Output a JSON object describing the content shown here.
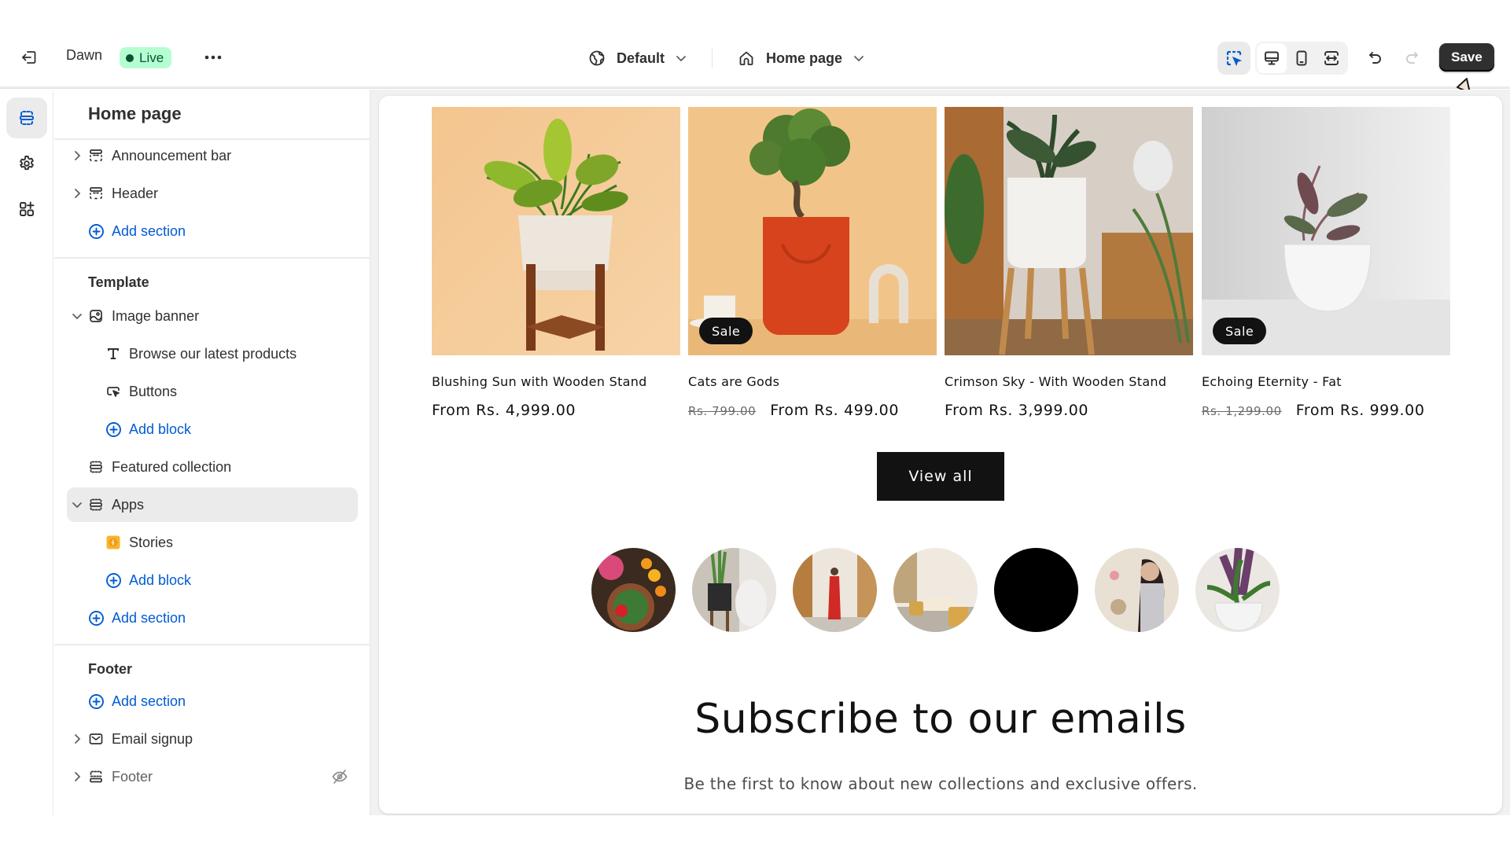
{
  "topbar": {
    "exit_icon": "exit-icon",
    "theme_name": "Dawn",
    "status_badge": "Live",
    "more_icon": "more-horizontal-icon",
    "more_label": "•••",
    "market_selector": {
      "icon": "globe-icon",
      "label": "Default"
    },
    "page_selector": {
      "icon": "home-icon",
      "label": "Home page"
    },
    "tools": [
      {
        "name": "inspector",
        "icon": "select-cursor-icon",
        "active": true
      },
      {
        "name": "desktop",
        "icon": "desktop-icon",
        "active": true
      },
      {
        "name": "mobile",
        "icon": "mobile-icon",
        "active": false
      },
      {
        "name": "full-width",
        "icon": "expand-horizontal-icon",
        "active": false
      },
      {
        "name": "undo",
        "icon": "undo-icon",
        "enabled": true
      },
      {
        "name": "redo",
        "icon": "redo-icon",
        "enabled": false
      }
    ],
    "save_label": "Save",
    "accent_color": "#005bd3"
  },
  "rail": {
    "items": [
      {
        "name": "sections",
        "icon": "sections-icon",
        "active": true
      },
      {
        "name": "theme-settings",
        "icon": "gear-icon",
        "active": false
      },
      {
        "name": "app-embeds",
        "icon": "apps-add-icon",
        "active": false
      }
    ]
  },
  "sidebar": {
    "title": "Home page",
    "header_group": {
      "items": [
        {
          "label": "Announcement bar",
          "icon": "section-icon",
          "expandable": true
        },
        {
          "label": "Header",
          "icon": "section-icon",
          "expandable": true
        },
        {
          "label": "Add section",
          "icon": "plus-circle-icon",
          "type": "add"
        }
      ]
    },
    "template_group": {
      "label": "Template",
      "items": [
        {
          "label": "Image banner",
          "icon": "image-icon",
          "expanded": true
        },
        {
          "label": "Browse our latest products",
          "icon": "text-icon",
          "level": 2
        },
        {
          "label": "Buttons",
          "icon": "button-icon",
          "level": 2
        },
        {
          "label": "Add block",
          "icon": "plus-circle-icon",
          "level": 2,
          "type": "add"
        },
        {
          "label": "Featured collection",
          "icon": "section-icon"
        },
        {
          "label": "Apps",
          "icon": "section-icon",
          "expanded": true,
          "selected": true
        },
        {
          "label": "Stories",
          "icon": "stories-app-icon",
          "level": 2
        },
        {
          "label": "Add block",
          "icon": "plus-circle-icon",
          "level": 2,
          "type": "add"
        },
        {
          "label": "Add section",
          "icon": "plus-circle-icon",
          "type": "add"
        }
      ]
    },
    "footer_group": {
      "label": "Footer",
      "items": [
        {
          "label": "Add section",
          "icon": "plus-circle-icon",
          "type": "add"
        },
        {
          "label": "Email signup",
          "icon": "email-icon",
          "expandable": true
        },
        {
          "label": "Footer",
          "icon": "footer-section-icon",
          "expandable": true,
          "hidden": true
        }
      ]
    }
  },
  "preview": {
    "products": [
      {
        "title": "Blushing Sun with Wooden Stand",
        "price": "From Rs. 4,999.00",
        "compare_price": null,
        "sale": false
      },
      {
        "title": "Cats are Gods",
        "price": "From Rs. 499.00",
        "compare_price": "Rs. 799.00",
        "sale": true
      },
      {
        "title": "Crimson Sky - With Wooden Stand",
        "price": "From Rs. 3,999.00",
        "compare_price": null,
        "sale": false
      },
      {
        "title": "Echoing Eternity - Fat",
        "price": "From Rs. 999.00",
        "compare_price": "Rs. 1,299.00",
        "sale": true
      }
    ],
    "sale_badge": "Sale",
    "view_all_label": "View all",
    "stories_count": 7,
    "subscribe_title": "Subscribe to our emails",
    "subscribe_subtitle": "Be the first to know about new collections and exclusive offers."
  }
}
